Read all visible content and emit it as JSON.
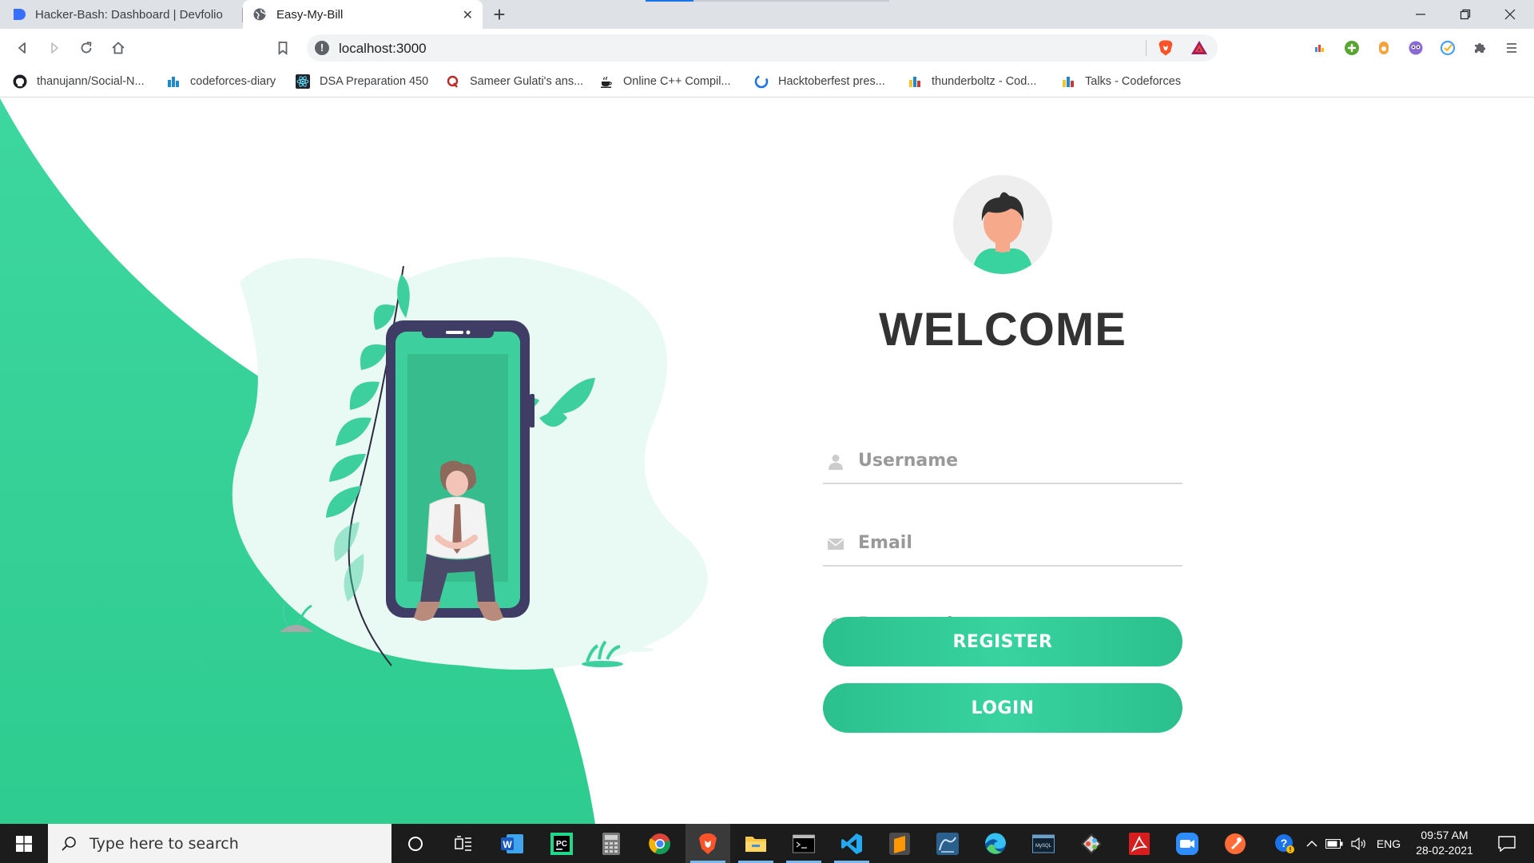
{
  "browser": {
    "tabs": [
      {
        "title": "Hacker-Bash: Dashboard | Devfolio",
        "active": false
      },
      {
        "title": "Easy-My-Bill",
        "active": true
      }
    ],
    "address": "localhost:3000",
    "bookmarks": [
      {
        "label": "thanujann/Social-N...",
        "icon": "github-icon"
      },
      {
        "label": "codeforces-diary",
        "icon": "codeforces-icon"
      },
      {
        "label": "DSA Preparation 450",
        "icon": "react-icon"
      },
      {
        "label": "Sameer Gulati's ans...",
        "icon": "quora-icon"
      },
      {
        "label": "Online C++ Compil...",
        "icon": "coffee-icon"
      },
      {
        "label": "Hacktoberfest pres...",
        "icon": "hacktoberfest-icon"
      },
      {
        "label": "thunderboltz - Cod...",
        "icon": "codeforces-icon"
      },
      {
        "label": "Talks - Codeforces",
        "icon": "codeforces-icon"
      }
    ]
  },
  "login": {
    "heading": "WELCOME",
    "username_placeholder": "Username",
    "email_placeholder": "Email",
    "password_placeholder": "Password",
    "register_label": "REGISTER",
    "login_label": "LOGIN"
  },
  "theme": {
    "accent": "#38d39f",
    "accent_dark": "#2bc08d",
    "heading_color": "#333333"
  },
  "taskbar": {
    "search_placeholder": "Type here to search",
    "language": "ENG",
    "time": "09:57 AM",
    "date": "28-02-2021"
  }
}
